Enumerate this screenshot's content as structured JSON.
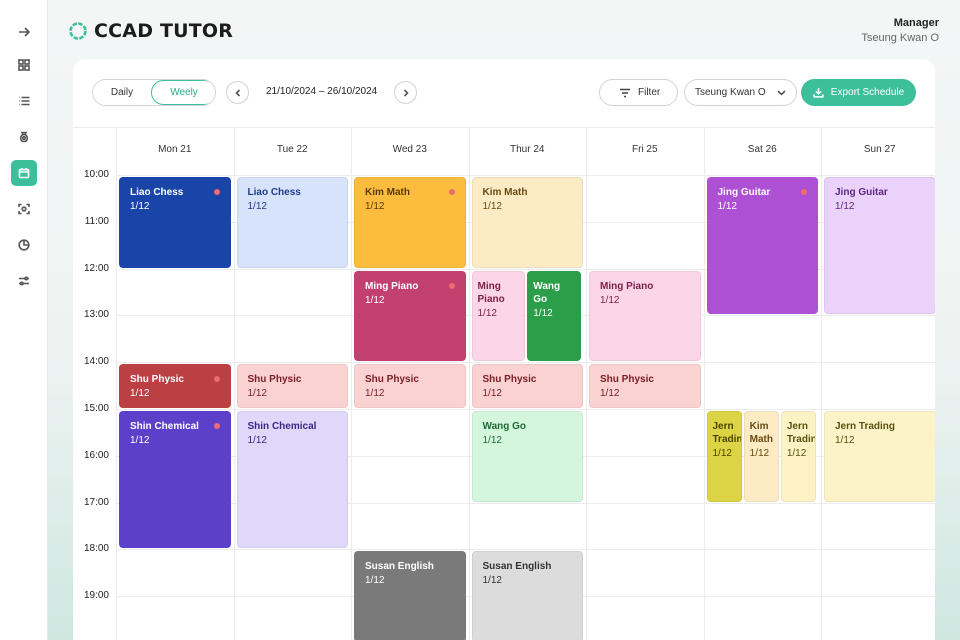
{
  "app": {
    "logo_text": "CCAD TUTOR",
    "accent": "#3dbf9c"
  },
  "user": {
    "role": "Manager",
    "name": "Tseung Kwan O"
  },
  "sidebar": {
    "items": [
      {
        "icon": "arrow-right-icon"
      },
      {
        "icon": "dashboard-icon"
      },
      {
        "icon": "list-icon"
      },
      {
        "icon": "money-bag-icon"
      },
      {
        "icon": "calendar-icon",
        "active": true
      },
      {
        "icon": "scan-icon"
      },
      {
        "icon": "pie-chart-icon"
      },
      {
        "icon": "settings-sliders-icon"
      }
    ]
  },
  "toolbar": {
    "daily_label": "Daily",
    "weekly_label": "Weely",
    "date_range": "21/10/2024 – 26/10/2024",
    "filter_label": "Filter",
    "location_value": "Tseung Kwan O",
    "export_label": "Export Schedule"
  },
  "calendar": {
    "days": [
      "Mon 21",
      "Tue 22",
      "Wed 23",
      "Thur 24",
      "Fri 25",
      "Sat 26",
      "Sun 27"
    ],
    "times": [
      "10:00",
      "11:00",
      "12:00",
      "13:00",
      "14:00",
      "15:00",
      "16:00",
      "17:00",
      "18:00",
      "19:00"
    ],
    "events": [
      {
        "title": "Liao Chess",
        "count": "1/12",
        "day": 0,
        "start": 10,
        "end": 12,
        "bg": "#1a45a8",
        "fg": "#ffffff",
        "dot": true
      },
      {
        "title": "Shu Physic",
        "count": "1/12",
        "day": 0,
        "start": 14,
        "end": 15,
        "bg": "#bb4043",
        "fg": "#ffffff",
        "dot": true
      },
      {
        "title": "Shin Chemical",
        "count": "1/12",
        "day": 0,
        "start": 15,
        "end": 18,
        "bg": "#5d40c9",
        "fg": "#ffffff",
        "dot": true
      },
      {
        "title": "Liao Chess",
        "count": "1/12",
        "day": 1,
        "start": 10,
        "end": 12,
        "bg": "#d7e2fb",
        "fg": "#1e3d8a"
      },
      {
        "title": "Shu Physic",
        "count": "1/12",
        "day": 1,
        "start": 14,
        "end": 15,
        "bg": "#fbd2d2",
        "fg": "#7a2025"
      },
      {
        "title": "Shin Chemical",
        "count": "1/12",
        "day": 1,
        "start": 15,
        "end": 18,
        "bg": "#e0d8fb",
        "fg": "#3a2785"
      },
      {
        "title": "Kim Math",
        "count": "1/12",
        "day": 2,
        "start": 10,
        "end": 12,
        "bg": "#fcbd3f",
        "fg": "#5a3a00",
        "dot": true
      },
      {
        "title": "Ming Piano",
        "count": "1/12",
        "day": 2,
        "start": 12,
        "end": 14,
        "bg": "#c2406e",
        "fg": "#ffffff",
        "dot": true
      },
      {
        "title": "Shu Physic",
        "count": "1/12",
        "day": 2,
        "start": 14,
        "end": 15,
        "bg": "#fbd2d2",
        "fg": "#7a2025"
      },
      {
        "title": "Susan English",
        "count": "1/12",
        "day": 2,
        "start": 18,
        "end": 20,
        "bg": "#7a7a7a",
        "fg": "#ffffff"
      },
      {
        "title": "Kim Math",
        "count": "1/12",
        "day": 3,
        "start": 10,
        "end": 12,
        "bg": "#fdebc6",
        "fg": "#6a4a10"
      },
      {
        "title": "Ming Piano",
        "count": "1/12",
        "day": 3,
        "start": 12,
        "end": 14,
        "bg": "#fcd6e8",
        "fg": "#7a1f48",
        "sub": 0,
        "subs": 2
      },
      {
        "title": "Wang Go",
        "count": "1/12",
        "day": 3,
        "start": 12,
        "end": 14,
        "bg": "#2a9e48",
        "fg": "#ffffff",
        "sub": 1,
        "subs": 2
      },
      {
        "title": "Shu Physic",
        "count": "1/12",
        "day": 3,
        "start": 14,
        "end": 15,
        "bg": "#fbd2d2",
        "fg": "#7a2025"
      },
      {
        "title": "Wang Go",
        "count": "1/12",
        "day": 3,
        "start": 15,
        "end": 17,
        "bg": "#d4f6dd",
        "fg": "#1f6b37"
      },
      {
        "title": "Susan English",
        "count": "1/12",
        "day": 3,
        "start": 18,
        "end": 20,
        "bg": "#dcdcdc",
        "fg": "#333333"
      },
      {
        "title": "Ming Piano",
        "count": "1/12",
        "day": 4,
        "start": 12,
        "end": 14,
        "bg": "#fcd6e8",
        "fg": "#7a1f48"
      },
      {
        "title": "Shu Physic",
        "count": "1/12",
        "day": 4,
        "start": 14,
        "end": 15,
        "bg": "#fbd2d2",
        "fg": "#7a2025"
      },
      {
        "title": "Jing Guitar",
        "count": "1/12",
        "day": 5,
        "start": 10,
        "end": 13,
        "bg": "#ad50d4",
        "fg": "#ffffff",
        "dot": true
      },
      {
        "title": "Jern Trading",
        "count": "1/12",
        "day": 5,
        "start": 15,
        "end": 17,
        "bg": "#ddd445",
        "fg": "#4a4500",
        "sub": 0,
        "subs": 3
      },
      {
        "title": "Kim Math",
        "count": "1/12",
        "day": 5,
        "start": 15,
        "end": 17,
        "bg": "#fdebc6",
        "fg": "#6a4a10",
        "sub": 1,
        "subs": 3
      },
      {
        "title": "Jern Trading",
        "count": "1/12",
        "day": 5,
        "start": 15,
        "end": 17,
        "bg": "#fcf2c4",
        "fg": "#5a5010",
        "sub": 2,
        "subs": 3
      },
      {
        "title": "Jing Guitar",
        "count": "1/12",
        "day": 6,
        "start": 10,
        "end": 13,
        "bg": "#ebd2fb",
        "fg": "#5e2585"
      },
      {
        "title": "Jern Trading",
        "count": "1/12",
        "day": 6,
        "start": 15,
        "end": 17,
        "bg": "#fcf3c8",
        "fg": "#5a5010"
      }
    ]
  }
}
